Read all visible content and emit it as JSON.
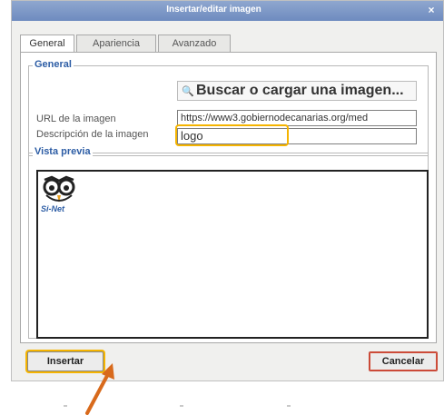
{
  "window": {
    "title": "Insertar/editar imagen",
    "close_symbol": "×"
  },
  "tabs": [
    {
      "label": "General",
      "active": true
    },
    {
      "label": "Apariencia",
      "active": false
    },
    {
      "label": "Avanzado",
      "active": false
    }
  ],
  "general": {
    "legend": "General",
    "browse_label": "Buscar o cargar una imagen...",
    "url_label": "URL de la imagen",
    "url_value": "https://www3.gobiernodecanarias.org/med",
    "desc_label": "Descripción de la imagen",
    "desc_value": "logo"
  },
  "preview": {
    "legend": "Vista previa",
    "logo_text": "Si-Net"
  },
  "buttons": {
    "insert": "Insertar",
    "cancel": "Cancelar"
  },
  "colors": {
    "highlight": "#f5b400",
    "arrow": "#d86a1c",
    "legend": "#2d5da5"
  }
}
